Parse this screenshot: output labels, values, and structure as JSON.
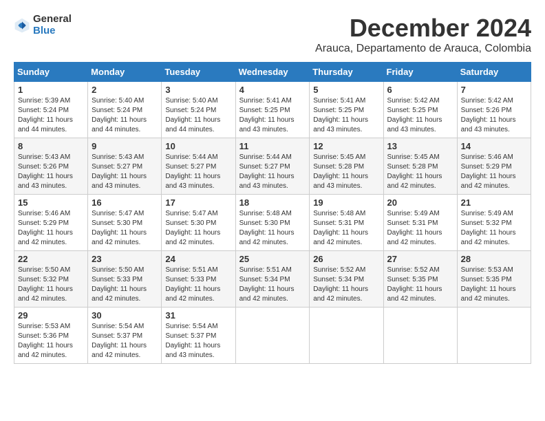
{
  "logo": {
    "general": "General",
    "blue": "Blue"
  },
  "header": {
    "month": "December 2024",
    "location": "Arauca, Departamento de Arauca, Colombia"
  },
  "days_of_week": [
    "Sunday",
    "Monday",
    "Tuesday",
    "Wednesday",
    "Thursday",
    "Friday",
    "Saturday"
  ],
  "weeks": [
    [
      {
        "day": "1",
        "sunrise": "Sunrise: 5:39 AM",
        "sunset": "Sunset: 5:24 PM",
        "daylight": "Daylight: 11 hours and 44 minutes."
      },
      {
        "day": "2",
        "sunrise": "Sunrise: 5:40 AM",
        "sunset": "Sunset: 5:24 PM",
        "daylight": "Daylight: 11 hours and 44 minutes."
      },
      {
        "day": "3",
        "sunrise": "Sunrise: 5:40 AM",
        "sunset": "Sunset: 5:24 PM",
        "daylight": "Daylight: 11 hours and 44 minutes."
      },
      {
        "day": "4",
        "sunrise": "Sunrise: 5:41 AM",
        "sunset": "Sunset: 5:25 PM",
        "daylight": "Daylight: 11 hours and 43 minutes."
      },
      {
        "day": "5",
        "sunrise": "Sunrise: 5:41 AM",
        "sunset": "Sunset: 5:25 PM",
        "daylight": "Daylight: 11 hours and 43 minutes."
      },
      {
        "day": "6",
        "sunrise": "Sunrise: 5:42 AM",
        "sunset": "Sunset: 5:25 PM",
        "daylight": "Daylight: 11 hours and 43 minutes."
      },
      {
        "day": "7",
        "sunrise": "Sunrise: 5:42 AM",
        "sunset": "Sunset: 5:26 PM",
        "daylight": "Daylight: 11 hours and 43 minutes."
      }
    ],
    [
      {
        "day": "8",
        "sunrise": "Sunrise: 5:43 AM",
        "sunset": "Sunset: 5:26 PM",
        "daylight": "Daylight: 11 hours and 43 minutes."
      },
      {
        "day": "9",
        "sunrise": "Sunrise: 5:43 AM",
        "sunset": "Sunset: 5:27 PM",
        "daylight": "Daylight: 11 hours and 43 minutes."
      },
      {
        "day": "10",
        "sunrise": "Sunrise: 5:44 AM",
        "sunset": "Sunset: 5:27 PM",
        "daylight": "Daylight: 11 hours and 43 minutes."
      },
      {
        "day": "11",
        "sunrise": "Sunrise: 5:44 AM",
        "sunset": "Sunset: 5:27 PM",
        "daylight": "Daylight: 11 hours and 43 minutes."
      },
      {
        "day": "12",
        "sunrise": "Sunrise: 5:45 AM",
        "sunset": "Sunset: 5:28 PM",
        "daylight": "Daylight: 11 hours and 43 minutes."
      },
      {
        "day": "13",
        "sunrise": "Sunrise: 5:45 AM",
        "sunset": "Sunset: 5:28 PM",
        "daylight": "Daylight: 11 hours and 42 minutes."
      },
      {
        "day": "14",
        "sunrise": "Sunrise: 5:46 AM",
        "sunset": "Sunset: 5:29 PM",
        "daylight": "Daylight: 11 hours and 42 minutes."
      }
    ],
    [
      {
        "day": "15",
        "sunrise": "Sunrise: 5:46 AM",
        "sunset": "Sunset: 5:29 PM",
        "daylight": "Daylight: 11 hours and 42 minutes."
      },
      {
        "day": "16",
        "sunrise": "Sunrise: 5:47 AM",
        "sunset": "Sunset: 5:30 PM",
        "daylight": "Daylight: 11 hours and 42 minutes."
      },
      {
        "day": "17",
        "sunrise": "Sunrise: 5:47 AM",
        "sunset": "Sunset: 5:30 PM",
        "daylight": "Daylight: 11 hours and 42 minutes."
      },
      {
        "day": "18",
        "sunrise": "Sunrise: 5:48 AM",
        "sunset": "Sunset: 5:30 PM",
        "daylight": "Daylight: 11 hours and 42 minutes."
      },
      {
        "day": "19",
        "sunrise": "Sunrise: 5:48 AM",
        "sunset": "Sunset: 5:31 PM",
        "daylight": "Daylight: 11 hours and 42 minutes."
      },
      {
        "day": "20",
        "sunrise": "Sunrise: 5:49 AM",
        "sunset": "Sunset: 5:31 PM",
        "daylight": "Daylight: 11 hours and 42 minutes."
      },
      {
        "day": "21",
        "sunrise": "Sunrise: 5:49 AM",
        "sunset": "Sunset: 5:32 PM",
        "daylight": "Daylight: 11 hours and 42 minutes."
      }
    ],
    [
      {
        "day": "22",
        "sunrise": "Sunrise: 5:50 AM",
        "sunset": "Sunset: 5:32 PM",
        "daylight": "Daylight: 11 hours and 42 minutes."
      },
      {
        "day": "23",
        "sunrise": "Sunrise: 5:50 AM",
        "sunset": "Sunset: 5:33 PM",
        "daylight": "Daylight: 11 hours and 42 minutes."
      },
      {
        "day": "24",
        "sunrise": "Sunrise: 5:51 AM",
        "sunset": "Sunset: 5:33 PM",
        "daylight": "Daylight: 11 hours and 42 minutes."
      },
      {
        "day": "25",
        "sunrise": "Sunrise: 5:51 AM",
        "sunset": "Sunset: 5:34 PM",
        "daylight": "Daylight: 11 hours and 42 minutes."
      },
      {
        "day": "26",
        "sunrise": "Sunrise: 5:52 AM",
        "sunset": "Sunset: 5:34 PM",
        "daylight": "Daylight: 11 hours and 42 minutes."
      },
      {
        "day": "27",
        "sunrise": "Sunrise: 5:52 AM",
        "sunset": "Sunset: 5:35 PM",
        "daylight": "Daylight: 11 hours and 42 minutes."
      },
      {
        "day": "28",
        "sunrise": "Sunrise: 5:53 AM",
        "sunset": "Sunset: 5:35 PM",
        "daylight": "Daylight: 11 hours and 42 minutes."
      }
    ],
    [
      {
        "day": "29",
        "sunrise": "Sunrise: 5:53 AM",
        "sunset": "Sunset: 5:36 PM",
        "daylight": "Daylight: 11 hours and 42 minutes."
      },
      {
        "day": "30",
        "sunrise": "Sunrise: 5:54 AM",
        "sunset": "Sunset: 5:37 PM",
        "daylight": "Daylight: 11 hours and 42 minutes."
      },
      {
        "day": "31",
        "sunrise": "Sunrise: 5:54 AM",
        "sunset": "Sunset: 5:37 PM",
        "daylight": "Daylight: 11 hours and 43 minutes."
      },
      null,
      null,
      null,
      null
    ]
  ]
}
